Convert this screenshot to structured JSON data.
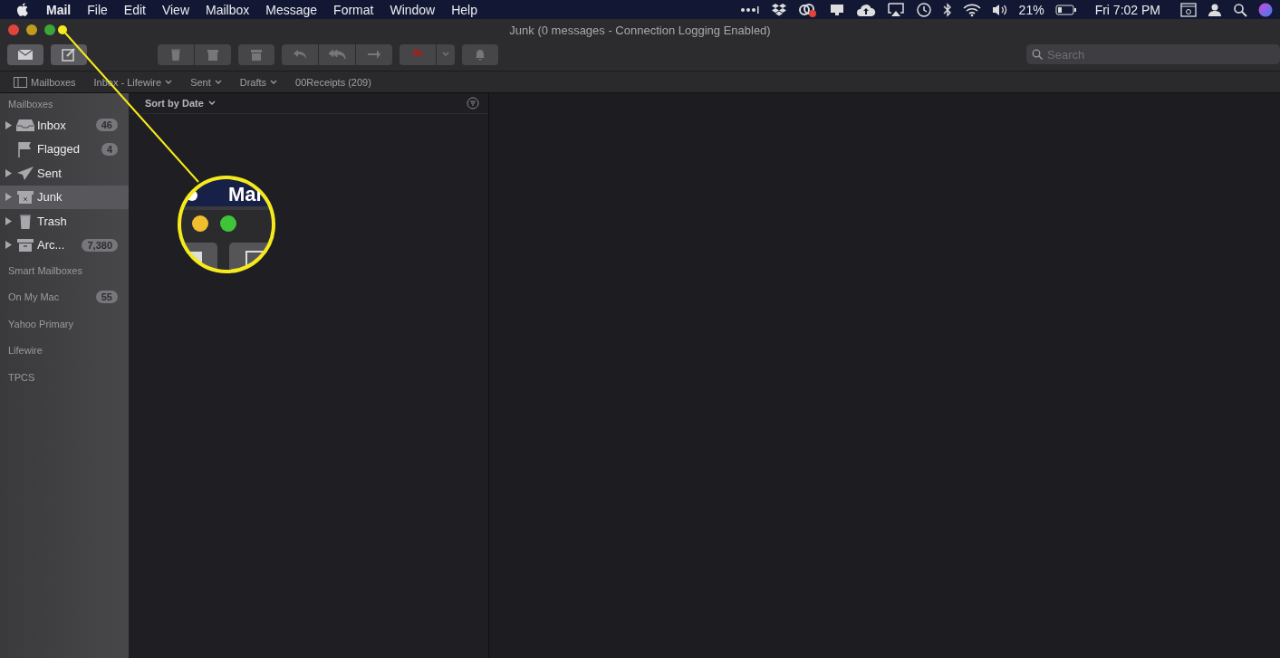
{
  "menu_bar": {
    "app_name": "Mail",
    "items": [
      "File",
      "Edit",
      "View",
      "Mailbox",
      "Message",
      "Format",
      "Window",
      "Help"
    ],
    "battery": "21%",
    "clock": "Fri 7:02 PM"
  },
  "window": {
    "title": "Junk (0 messages - Connection Logging Enabled)",
    "search": {
      "placeholder": "Search"
    }
  },
  "favorites": [
    {
      "label": "Mailboxes",
      "kind": "toggle"
    },
    {
      "label": "Inbox - Lifewire",
      "kind": "menu"
    },
    {
      "label": "Sent",
      "kind": "menu"
    },
    {
      "label": "Drafts",
      "kind": "menu"
    },
    {
      "label": "00Receipts (209)",
      "kind": "plain"
    }
  ],
  "sidebar": {
    "title": "Mailboxes",
    "items": [
      {
        "label": "Inbox",
        "kind": "inbox",
        "badge": "46",
        "disclosure": true,
        "selected": false
      },
      {
        "label": "Flagged",
        "kind": "flag",
        "badge": "4",
        "disclosure": false,
        "selected": false
      },
      {
        "label": "Sent",
        "kind": "sent",
        "disclosure": true,
        "selected": false
      },
      {
        "label": "Junk",
        "kind": "junk",
        "disclosure": true,
        "selected": true
      },
      {
        "label": "Trash",
        "kind": "trash",
        "disclosure": true,
        "selected": false
      },
      {
        "label": "Arc...",
        "kind": "archive",
        "badge": "7,380",
        "disclosure": true,
        "selected": false
      }
    ],
    "accounts": [
      {
        "label": "Smart Mailboxes"
      },
      {
        "label": "On My Mac",
        "badge": "55"
      },
      {
        "label": "Yahoo Primary"
      },
      {
        "label": "Lifewire"
      },
      {
        "label": "TPCS"
      }
    ]
  },
  "message_list": {
    "sort_label": "Sort by Date"
  },
  "callout": {
    "text": "Mai"
  }
}
